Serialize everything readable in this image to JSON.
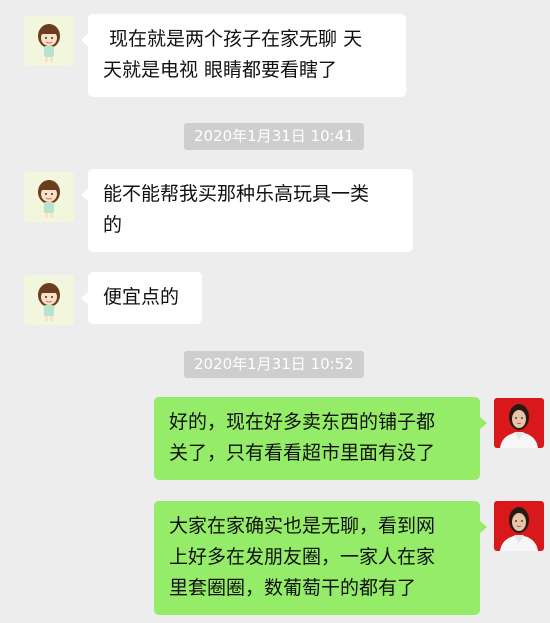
{
  "theme": {
    "background": "#ededed",
    "incoming_bubble": "#ffffff",
    "outgoing_bubble": "#95ec69",
    "timestamp_bg": "#cecece"
  },
  "messages": [
    {
      "direction": "incoming",
      "avatar": "cartoon-girl-avatar",
      "text": " 现在就是两个孩子在家无聊 天\n天就是电视 眼睛都要看瞎了"
    },
    {
      "type": "timestamp",
      "text": "2020年1月31日 10:41"
    },
    {
      "direction": "incoming",
      "avatar": "cartoon-girl-avatar",
      "text": "能不能帮我买那种乐高玩具一类\n的"
    },
    {
      "direction": "incoming",
      "avatar": "cartoon-girl-avatar",
      "text": "便宜点的"
    },
    {
      "type": "timestamp",
      "text": "2020年1月31日 10:52"
    },
    {
      "direction": "outgoing",
      "avatar": "user-photo-avatar",
      "text": "好的，现在好多卖东西的铺子都\n关了，只有看看超市里面有没了"
    },
    {
      "direction": "outgoing",
      "avatar": "user-photo-avatar",
      "text": "大家在家确实也是无聊，看到网\n上好多在发朋友圈，一家人在家\n里套圈圈，数葡萄干的都有了"
    }
  ]
}
